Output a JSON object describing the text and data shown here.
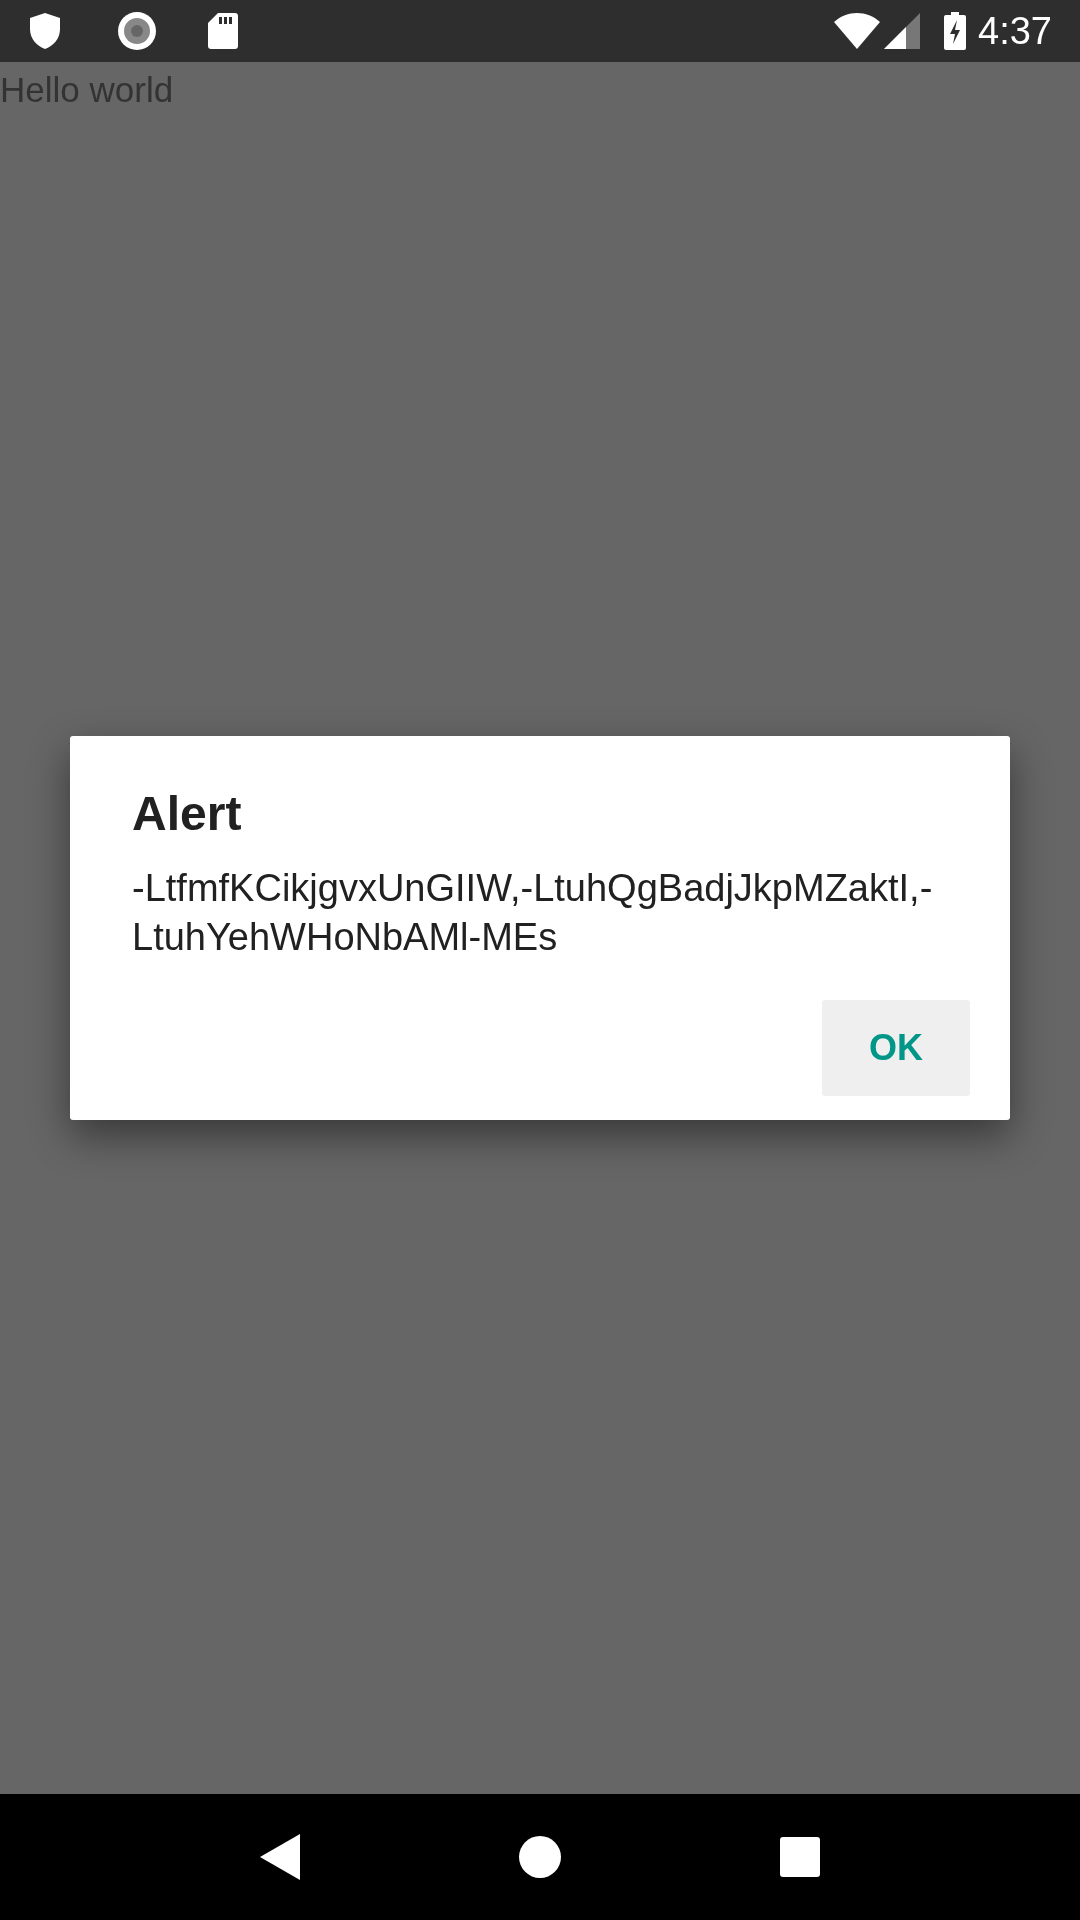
{
  "status_bar": {
    "time": "4:37"
  },
  "screen": {
    "text": "Hello world"
  },
  "dialog": {
    "title": "Alert",
    "message": "-LtfmfKCikjgvxUnGIIW,-LtuhQgBadjJkpMZaktI,-LtuhYehWHoNbAMl-MEs",
    "buttons": [
      "OK"
    ]
  }
}
